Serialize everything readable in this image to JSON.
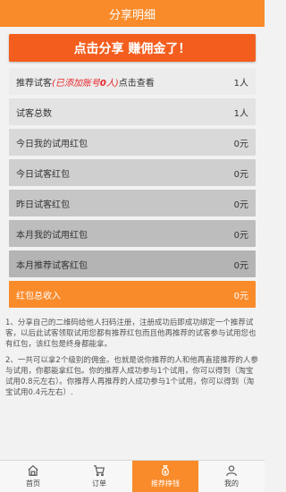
{
  "header": {
    "title": "分享明细"
  },
  "banner": {
    "label": "点击分享 赚佣金了！"
  },
  "rows": [
    {
      "label_pre": "推荐试客",
      "label_red": "(已添加账号",
      "label_red_bold": "0",
      "label_red_post": "人)",
      "label_post": "点击查看",
      "value": "1人"
    },
    {
      "label": "试客总数",
      "value": "1人"
    },
    {
      "label": "今日我的试用红包",
      "value": "0元"
    },
    {
      "label": "今日试客红包",
      "value": "0元"
    },
    {
      "label": "昨日试客红包",
      "value": "0元"
    },
    {
      "label": "本月我的试用红包",
      "value": "0元"
    },
    {
      "label": "本月推荐试客红包",
      "value": "0元"
    },
    {
      "label": "红包总收入",
      "value": "0元"
    }
  ],
  "notes": [
    "1、分享自己的二维码给他人扫码注册，注册成功后即成功绑定一个推荐试客，以后此试客领取试用您都有推荐红包而且他再推荐的试客参与试用您也有红包，该红包是终身都能拿。",
    "2、一共可以拿2个级别的佣金。也就是说你推荐的人和他再直接推荐的人参与试用，你都能拿红包。你的推荐人成功参与1个试用，你可以得到（淘宝试用0.8元左右）。你推荐人再推荐的人成功参与1个试用，你可以得到（淘宝试用0.4元左右）."
  ],
  "tabs": [
    {
      "label": "首页",
      "icon": "home-icon"
    },
    {
      "label": "订单",
      "icon": "cart-icon"
    },
    {
      "label": "推荐挣钱",
      "icon": "money-bag-icon",
      "active": true
    },
    {
      "label": "我的",
      "icon": "user-icon"
    }
  ],
  "colors": {
    "accent": "#f98b2b",
    "banner": "#f35e1f",
    "red": "#e8262a"
  }
}
